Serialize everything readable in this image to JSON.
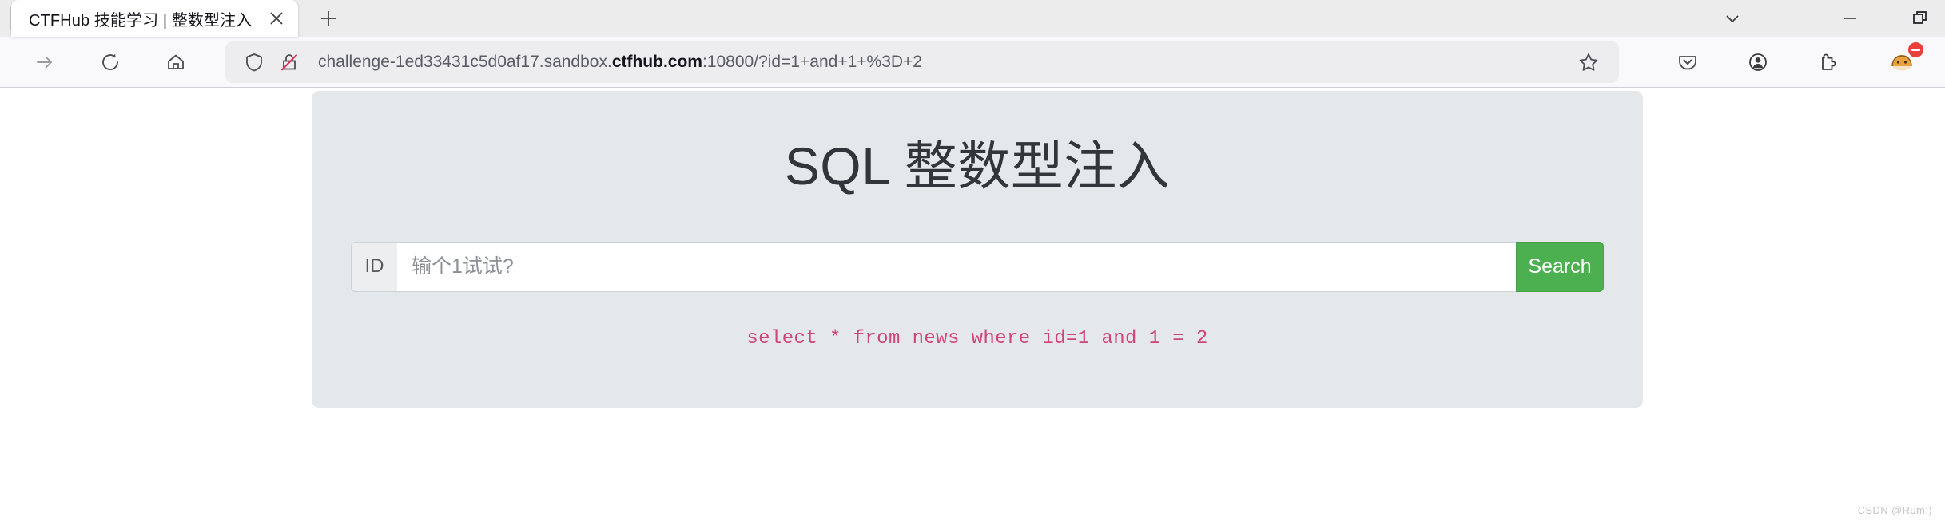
{
  "browser": {
    "tab": {
      "title": "CTFHub 技能学习 | 整数型注入",
      "close_label": "Close tab",
      "newtab_label": "New tab"
    },
    "window_controls": {
      "alltabs_label": "List all tabs",
      "minimize_label": "Minimize",
      "restore_label": "Restore"
    },
    "nav": {
      "forward_label": "Forward",
      "reload_label": "Reload",
      "home_label": "Home"
    },
    "url": {
      "prefix": "challenge-1ed33431c5d0af17.sandbox.",
      "host": "ctfhub.com",
      "suffix": ":10800/?id=1+and+1+%3D+2",
      "full": "challenge-1ed33431c5d0af17.sandbox.ctfhub.com:10800/?id=1+and+1+%3D+2",
      "shield_label": "Tracking protection",
      "lock_label": "Connection is not secure",
      "bookmark_label": "Bookmark this page"
    },
    "toolbar_right": {
      "pocket_label": "Save to Pocket",
      "account_label": "Account",
      "extensions_label": "Extensions",
      "extension_label": "Extension",
      "badge_count": ""
    }
  },
  "page": {
    "title": "SQL 整数型注入",
    "form": {
      "prefix_label": "ID",
      "input_value": "",
      "input_placeholder": "输个1试试?",
      "submit_label": "Search"
    },
    "query_output": "select * from news where id=1 and 1 = 2"
  },
  "watermark": "CSDN @Rum:)",
  "colors": {
    "accent_green": "#4caf50",
    "card_bg": "#e5e8ea",
    "code_pink": "#cf4577",
    "badge_red": "#e8403a"
  }
}
